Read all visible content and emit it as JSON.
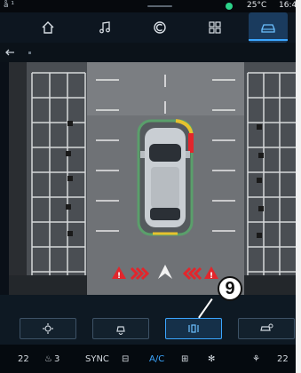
{
  "status": {
    "left_icons": "å ¹",
    "temperature": "25°C",
    "time": "16:4"
  },
  "nav": {
    "items": [
      {
        "icon": "home-icon"
      },
      {
        "icon": "music-icon"
      },
      {
        "icon": "navigation-icon"
      },
      {
        "icon": "apps-icon"
      },
      {
        "icon": "car-icon",
        "active": true
      }
    ]
  },
  "camera": {
    "callout_label": "9"
  },
  "controls": {
    "buttons": [
      {
        "icon": "sensor-settings-icon"
      },
      {
        "icon": "camera-view-icon"
      },
      {
        "icon": "parking-sensor-icon",
        "active": true
      },
      {
        "icon": "camera-settings-icon"
      }
    ]
  },
  "climate": {
    "left_temp": "22",
    "left_seat": "3",
    "sync": "SYNC",
    "ac": "A/C",
    "right_temp": "22"
  },
  "colors": {
    "accent": "#3ba6ff",
    "warning": "#e2262c",
    "sensor_green": "#5a9f6b",
    "sensor_yellow": "#e6c22e"
  }
}
